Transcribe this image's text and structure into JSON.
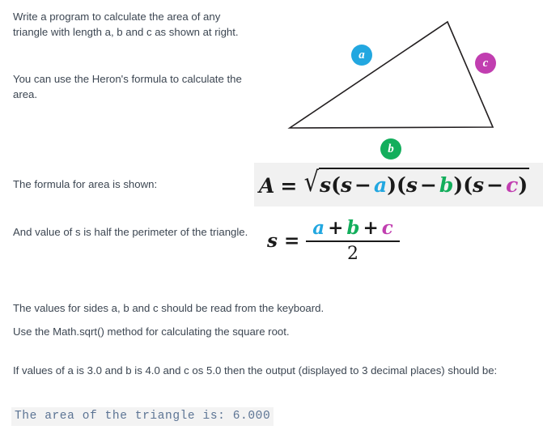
{
  "intro": {
    "paragraph_1": "Write a program to calculate the area of any triangle with length a, b and c as shown at right.",
    "paragraph_2": "You can use the Heron's formula to calculate the area."
  },
  "figure": {
    "name": "triangle-diagram",
    "side_labels": [
      {
        "id": "a",
        "text": "a",
        "color": "#22a7e0"
      },
      {
        "id": "b",
        "text": "b",
        "color": "#13ae5c"
      },
      {
        "id": "c",
        "text": "c",
        "color": "#c13eb0"
      }
    ],
    "stroke_color": "#231f20"
  },
  "labels": {
    "formula_intro": "The formula for area is shown:",
    "s_intro": "And value of s is half the perimeter of the triangle."
  },
  "formulas": {
    "area": {
      "lhs": "A",
      "equals": "=",
      "radical": "√",
      "radicand_parts": [
        {
          "text": "s",
          "kind": "var-s"
        },
        {
          "text": "(",
          "kind": "paren"
        },
        {
          "text": "s",
          "kind": "var-s"
        },
        {
          "text": "−",
          "kind": "op"
        },
        {
          "text": "a",
          "kind": "var-a"
        },
        {
          "text": ")(",
          "kind": "paren"
        },
        {
          "text": "s",
          "kind": "var-s"
        },
        {
          "text": "−",
          "kind": "op"
        },
        {
          "text": "b",
          "kind": "var-b"
        },
        {
          "text": ")(",
          "kind": "paren"
        },
        {
          "text": "s",
          "kind": "var-s"
        },
        {
          "text": "−",
          "kind": "op"
        },
        {
          "text": "c",
          "kind": "var-c"
        },
        {
          "text": ")",
          "kind": "paren"
        }
      ],
      "plain": "A = √s(s − a)(s − b)(s − c)",
      "band_color": "#f1f1f1"
    },
    "semi_perimeter": {
      "lhs": "s",
      "equals": "=",
      "numerator": {
        "a": "a",
        "plus_1": "+",
        "b": "b",
        "plus_2": "+",
        "c": "c"
      },
      "denominator": "2",
      "plain": "s = (a + b + c) / 2"
    }
  },
  "instructions": {
    "line_1": "The values for sides a, b and c should be read from the keyboard.",
    "line_2": "Use the Math.sqrt() method for calculating the square root.",
    "line_3": "If values of a is 3.0 and b is 4.0 and c os 5.0 then the output (displayed to 3 decimal places) should be:"
  },
  "output": {
    "code_line": "The area of the triangle is: 6.000",
    "background": "#f3f3f3",
    "text_color": "#5c7494"
  }
}
